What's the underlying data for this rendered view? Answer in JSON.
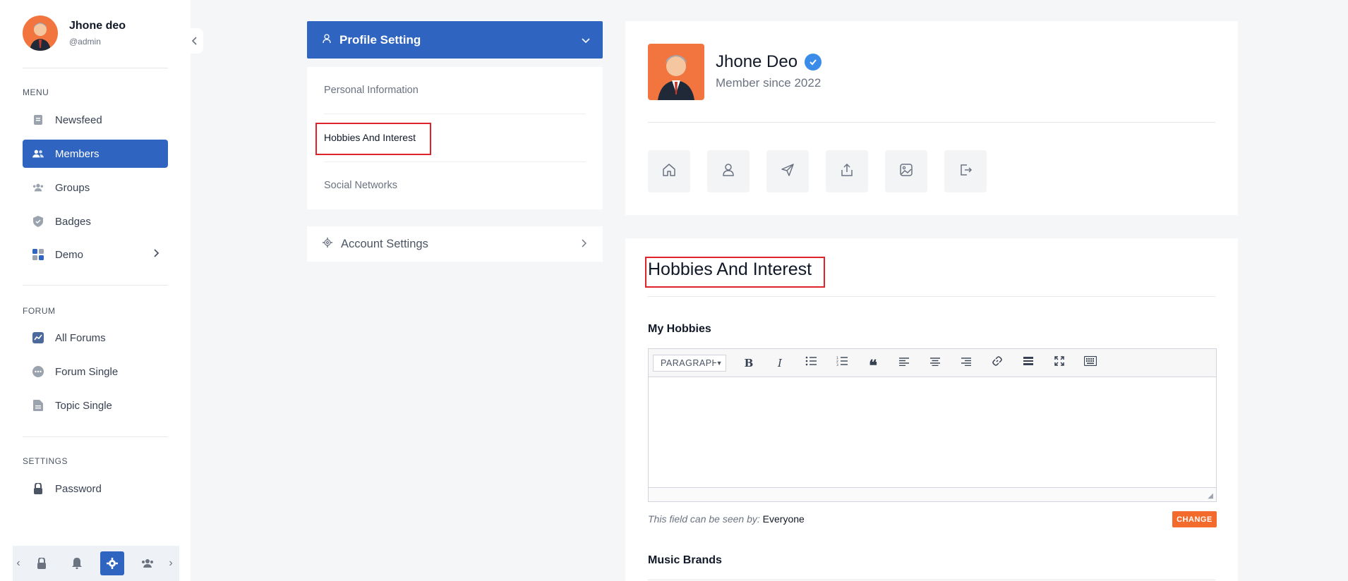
{
  "sidebar": {
    "user": {
      "name": "Jhone deo",
      "handle": "@admin"
    },
    "sections": {
      "menu": "MENU",
      "forum": "FORUM",
      "settings": "SETTINGS"
    },
    "menu_items": [
      {
        "label": "Newsfeed",
        "icon": "newsfeed-icon"
      },
      {
        "label": "Members",
        "icon": "members-icon",
        "active": true
      },
      {
        "label": "Groups",
        "icon": "groups-icon"
      },
      {
        "label": "Badges",
        "icon": "badges-icon"
      },
      {
        "label": "Demo",
        "icon": "demo-icon"
      }
    ],
    "forum_items": [
      {
        "label": "All Forums",
        "icon": "forums-icon"
      },
      {
        "label": "Forum Single",
        "icon": "chat-icon"
      },
      {
        "label": "Topic Single",
        "icon": "document-icon"
      }
    ],
    "settings_items": [
      {
        "label": "Password",
        "icon": "lock-icon"
      }
    ],
    "bottom_bar": [
      "lock-icon",
      "bell-icon",
      "settings-icon",
      "users-icon"
    ]
  },
  "settings_menu": {
    "profile_header": "Profile Setting",
    "items": [
      "Personal Information",
      "Hobbies And Interest",
      "Social Networks"
    ],
    "account": "Account Settings"
  },
  "profile": {
    "name": "Jhone Deo",
    "since": "Member since 2022",
    "actions": [
      "home-icon",
      "user-icon",
      "send-icon",
      "share-icon",
      "image-icon",
      "logout-icon"
    ]
  },
  "hobbies": {
    "title": "Hobbies And Interest",
    "field_label": "My Hobbies",
    "paragraph_select": "PARAGRAPH",
    "visibility_prefix": "This field can be seen by:",
    "visibility_value": "Everyone",
    "change_label": "CHANGE",
    "next_label": "Music Brands"
  },
  "colors": {
    "primary": "#2f64c0",
    "accent": "#f26b2c",
    "highlight": "#e0222a",
    "verified": "#3b8be8"
  }
}
